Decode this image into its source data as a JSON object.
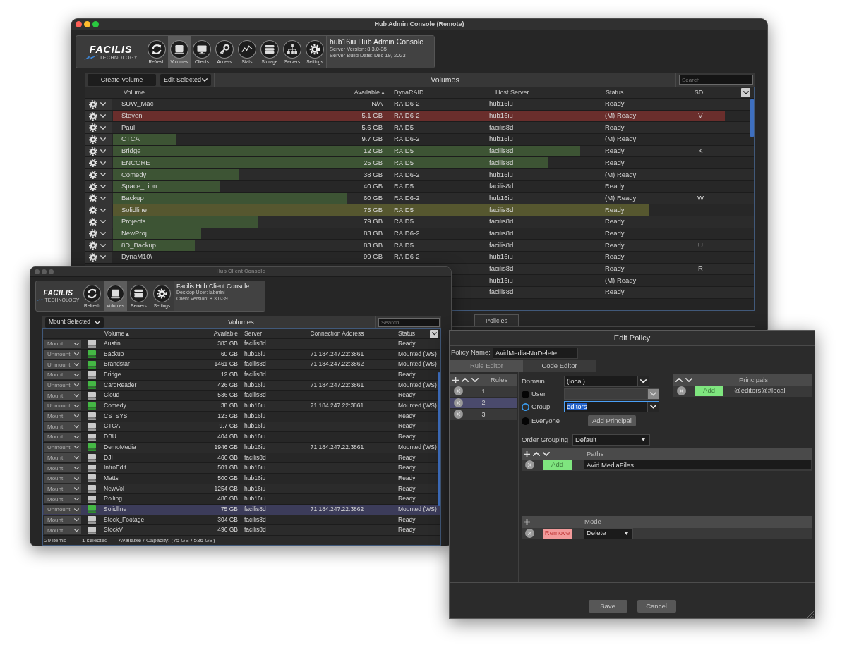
{
  "admin_window": {
    "title": "Hub Admin Console (Remote)",
    "active": true,
    "toolbar": {
      "logo": "FACILIS",
      "logo_tagline": "TECHNOLOGY",
      "buttons": [
        {
          "label": "Refresh",
          "selected": false
        },
        {
          "label": "Volumes",
          "selected": true
        },
        {
          "label": "Clients",
          "selected": false
        },
        {
          "label": "Access",
          "selected": false
        },
        {
          "label": "Stats",
          "selected": false
        },
        {
          "label": "Storage",
          "selected": false
        },
        {
          "label": "Servers",
          "selected": false
        },
        {
          "label": "Settings",
          "selected": false
        }
      ],
      "info": {
        "title": "hub16iu Hub Admin Console",
        "lines": [
          "Server Version: 8.3.0-35",
          "Server Build Date: Dec 19, 2023"
        ]
      }
    },
    "volumes": {
      "create_button": "Create Volume",
      "action_menu": "Edit Selected",
      "title": "Volumes",
      "search": {
        "placeholder": "Search"
      },
      "columns": [
        {
          "label": "Volume",
          "sorted": false
        },
        {
          "label": "Available",
          "sorted": true
        },
        {
          "label": "DynaRAID",
          "sorted": false
        },
        {
          "label": "Host Server",
          "sorted": false
        },
        {
          "label": "Status",
          "sorted": false
        },
        {
          "label": "SDL",
          "sorted": false
        }
      ],
      "rows": [
        {
          "volume": "SUW_Mac",
          "available": "N/A",
          "raid": "RAID6-2",
          "host": "hub16iu",
          "status": "Ready"
        },
        {
          "volume": "Steven",
          "available": "5.1 GB",
          "raid": "RAID6-2",
          "host": "hub16iu",
          "status": "(M) Ready",
          "sdl": "V",
          "level": 0.97,
          "color": "#6a2e2c"
        },
        {
          "volume": "Paul",
          "available": "5.6 GB",
          "raid": "RAID5",
          "host": "facilis8d",
          "status": "Ready"
        },
        {
          "volume": "CTCA",
          "available": "9.7 GB",
          "raid": "RAID6-2",
          "host": "hub16iu",
          "status": "(M) Ready",
          "level": 0.1,
          "color": "#3d5434"
        },
        {
          "volume": "Bridge",
          "available": "12 GB",
          "raid": "RAID5",
          "host": "facilis8d",
          "status": "Ready",
          "sdl": "K",
          "level": 0.74,
          "color": "#3d5434"
        },
        {
          "volume": "ENCORE",
          "available": "25 GB",
          "raid": "RAID5",
          "host": "facilis8d",
          "status": "Ready",
          "level": 0.69,
          "color": "#3d5434"
        },
        {
          "volume": "Comedy",
          "available": "38 GB",
          "raid": "RAID6-2",
          "host": "hub16iu",
          "status": "(M) Ready",
          "level": 0.2,
          "color": "#3d5434"
        },
        {
          "volume": "Space_Lion",
          "available": "40 GB",
          "raid": "RAID5",
          "host": "facilis8d",
          "status": "Ready",
          "level": 0.17,
          "color": "#3d5434"
        },
        {
          "volume": "Backup",
          "available": "60 GB",
          "raid": "RAID6-2",
          "host": "hub16iu",
          "status": "(M) Ready",
          "sdl": "W",
          "level": 0.37,
          "color": "#3d5434"
        },
        {
          "volume": "Solidline",
          "available": "75 GB",
          "raid": "RAID5",
          "host": "facilis8d",
          "status": "Ready",
          "level": 0.85,
          "color": "#56572f"
        },
        {
          "volume": "Projects",
          "available": "79 GB",
          "raid": "RAID5",
          "host": "facilis8d",
          "status": "Ready",
          "level": 0.23,
          "color": "#3d5434"
        },
        {
          "volume": "NewProj",
          "available": "83 GB",
          "raid": "RAID6-2",
          "host": "facilis8d",
          "status": "Ready",
          "level": 0.14,
          "color": "#3d5434"
        },
        {
          "volume": "8D_Backup",
          "available": "83 GB",
          "raid": "RAID5",
          "host": "facilis8d",
          "status": "Ready",
          "sdl": "U",
          "level": 0.13,
          "color": "#3d5434"
        },
        {
          "volume": "DynaM10\\",
          "available": "99 GB",
          "raid": "RAID6-2",
          "host": "hub16iu",
          "status": "Ready"
        },
        {
          "host": "facilis8d",
          "status": "Ready",
          "sdl": "R"
        },
        {
          "host": "hub16iu",
          "status": "(M) Ready"
        },
        {
          "host": "facilis8d",
          "status": "Ready"
        }
      ]
    },
    "tabs": [
      {
        "label": "Policies"
      }
    ]
  },
  "client_window": {
    "title": "Hub Client Console",
    "active": false,
    "toolbar": {
      "logo": "FACILIS",
      "logo_tagline": "TECHNOLOGY",
      "buttons": [
        {
          "label": "Refresh",
          "selected": false
        },
        {
          "label": "Volumes",
          "selected": true
        },
        {
          "label": "Servers",
          "selected": false
        },
        {
          "label": "Settings",
          "selected": false
        }
      ],
      "info": {
        "title": "Facilis Hub Client Console",
        "lines": [
          "Desktop User: labmini",
          "Client Version: 8.3.0-39"
        ]
      }
    },
    "volumes": {
      "action_menu": "Mount Selected",
      "title": "Volumes",
      "search": {
        "placeholder": "Search"
      },
      "columns": [
        {
          "label": "Volume",
          "sorted": true
        },
        {
          "label": "Available",
          "sorted": false
        },
        {
          "label": "Server",
          "sorted": false
        },
        {
          "label": "Connection Address",
          "sorted": false
        },
        {
          "label": "Status",
          "sorted": false
        }
      ],
      "rows": [
        {
          "action": "Mount",
          "mounted": false,
          "volume": "Austin",
          "available": "383 GB",
          "server": "facilis8d",
          "status": "Ready",
          "selected": false
        },
        {
          "action": "Unmount",
          "mounted": true,
          "volume": "Backup",
          "available": "60 GB",
          "server": "hub16iu",
          "address": "71.184.247.22:3861",
          "status": "Mounted (WS)",
          "selected": false
        },
        {
          "action": "Unmount",
          "mounted": true,
          "volume": "Brandstar",
          "available": "1461 GB",
          "server": "facilis8d",
          "address": "71.184.247.22:3862",
          "status": "Mounted (WS)",
          "selected": false
        },
        {
          "action": "Mount",
          "mounted": false,
          "volume": "Bridge",
          "available": "12 GB",
          "server": "facilis8d",
          "status": "Ready",
          "selected": false
        },
        {
          "action": "Unmount",
          "mounted": true,
          "volume": "CardReader",
          "available": "426 GB",
          "server": "hub16iu",
          "address": "71.184.247.22:3861",
          "status": "Mounted (WS)",
          "selected": false
        },
        {
          "action": "Mount",
          "mounted": false,
          "volume": "Cloud",
          "available": "536 GB",
          "server": "facilis8d",
          "status": "Ready",
          "selected": false
        },
        {
          "action": "Unmount",
          "mounted": true,
          "volume": "Comedy",
          "available": "38 GB",
          "server": "hub16iu",
          "address": "71.184.247.22:3861",
          "status": "Mounted (WS)",
          "selected": false
        },
        {
          "action": "Mount",
          "mounted": false,
          "volume": "CS_SYS",
          "available": "123 GB",
          "server": "hub16iu",
          "status": "Ready",
          "selected": false
        },
        {
          "action": "Mount",
          "mounted": false,
          "volume": "CTCA",
          "available": "9.7 GB",
          "server": "hub16iu",
          "status": "Ready",
          "selected": false
        },
        {
          "action": "Mount",
          "mounted": false,
          "volume": "DBU",
          "available": "404 GB",
          "server": "hub16iu",
          "status": "Ready",
          "selected": false
        },
        {
          "action": "Unmount",
          "mounted": true,
          "volume": "DemoMedia",
          "available": "1946 GB",
          "server": "hub16iu",
          "address": "71.184.247.22:3861",
          "status": "Mounted (WS)",
          "selected": false
        },
        {
          "action": "Mount",
          "mounted": false,
          "volume": "DJI",
          "available": "460 GB",
          "server": "facilis8d",
          "status": "Ready",
          "selected": false
        },
        {
          "action": "Mount",
          "mounted": false,
          "volume": "IntroEdit",
          "available": "501 GB",
          "server": "hub16iu",
          "status": "Ready",
          "selected": false
        },
        {
          "action": "Mount",
          "mounted": false,
          "volume": "Matts",
          "available": "500 GB",
          "server": "hub16iu",
          "status": "Ready",
          "selected": false
        },
        {
          "action": "Mount",
          "mounted": false,
          "volume": "NewVol",
          "available": "1254 GB",
          "server": "hub16iu",
          "status": "Ready",
          "selected": false
        },
        {
          "action": "Mount",
          "mounted": false,
          "volume": "Rolling",
          "available": "486 GB",
          "server": "hub16iu",
          "status": "Ready",
          "selected": false
        },
        {
          "action": "Unmount",
          "mounted": true,
          "volume": "Solidline",
          "available": "75 GB",
          "server": "facilis8d",
          "address": "71.184.247.22:3862",
          "status": "Mounted (WS)",
          "selected": true
        },
        {
          "action": "Mount",
          "mounted": false,
          "volume": "Stock_Footage",
          "available": "304 GB",
          "server": "facilis8d",
          "status": "Ready",
          "selected": false
        },
        {
          "action": "Mount",
          "mounted": false,
          "volume": "StockV",
          "available": "496 GB",
          "server": "facilis8d",
          "status": "Ready",
          "selected": false
        }
      ]
    },
    "status_bar": [
      "29 items",
      "1 selected",
      "Available / Capacity: (75 GB / 536 GB)"
    ]
  },
  "edit_policy": {
    "title": "Edit Policy",
    "policy_name": {
      "label": "Policy Name:",
      "value": "AvidMedia-NoDelete"
    },
    "tabs": [
      {
        "label": "Rule Editor",
        "selected": true
      },
      {
        "label": "Code Editor",
        "selected": false
      }
    ],
    "rules": {
      "title": "Rules",
      "items": [
        {
          "label": "1",
          "selected": false
        },
        {
          "label": "2",
          "selected": true
        },
        {
          "label": "3",
          "selected": false
        }
      ]
    },
    "domain": {
      "label": "Domain",
      "value": "(local)"
    },
    "principal_types": [
      {
        "label": "User",
        "selected": false,
        "field": {
          "disabled": true,
          "focused": false
        }
      },
      {
        "label": "Group",
        "selected": true,
        "field": {
          "value": "editors",
          "disabled": false,
          "focused": true
        }
      },
      {
        "label": "Everyone",
        "selected": false,
        "button": "Add Principal"
      }
    ],
    "principals": {
      "title": "Principals",
      "items": [
        {
          "add_button": "Add",
          "value": "@editors@#local"
        }
      ]
    },
    "order_grouping": {
      "label": "Order Grouping",
      "value": "Default"
    },
    "paths": {
      "title": "Paths",
      "items": [
        {
          "add_button": "Add",
          "value": "Avid MediaFiles"
        }
      ]
    },
    "mode": {
      "title": "Mode",
      "items": [
        {
          "remove_button": "Remove",
          "value": "Delete"
        }
      ]
    },
    "buttons": [
      "Save",
      "Cancel"
    ]
  }
}
